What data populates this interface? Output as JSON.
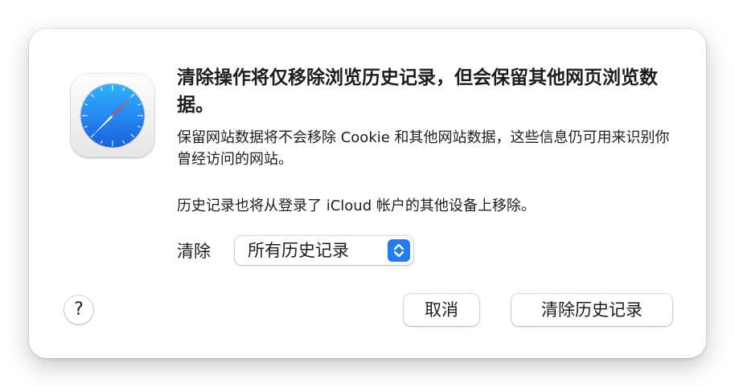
{
  "dialog": {
    "title": "清除操作将仅移除浏览历史记录，但会保留其他网页浏览数据。",
    "message_1": "保留网站数据将不会移除 Cookie 和其他网站数据，这些信息仍可用来识别你曾经访问的网站。",
    "message_2": "历史记录也将从登录了 iCloud 帐户的其他设备上移除。",
    "clear_label": "清除",
    "clear_range_selected": "所有历史记录",
    "help_label": "?",
    "cancel_label": "取消",
    "confirm_label": "清除历史记录",
    "app_icon": "safari-compass-icon",
    "accent_color": "#1f7cf2"
  }
}
